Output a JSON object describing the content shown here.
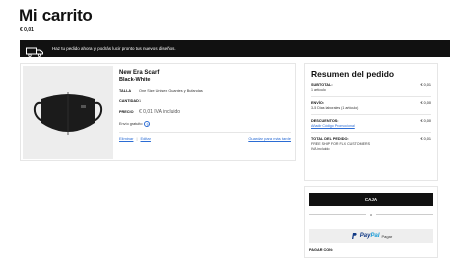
{
  "page": {
    "title": "Mi carrito",
    "total": "€ 0,01"
  },
  "banner": {
    "text": "Haz tu pedido ahora y podrás lucir pronto tus nuevos diseños.",
    "icon": "truck-icon"
  },
  "product": {
    "name": "New Era Scarf",
    "color": "Black-White",
    "attributes": [
      {
        "label": "TALLA",
        "value": "One Size Unisex Guantes y Bufandas"
      },
      {
        "label": "CANTIDAD",
        "value": "1"
      }
    ],
    "price_label": "PRECIO",
    "price_value": "€ 0,01 IVA incluido",
    "shipping_note": "Envío gratuito",
    "actions": {
      "remove": "Eliminar",
      "edit": "Editar",
      "wishlist": "Guardar para más tarde"
    }
  },
  "summary": {
    "title": "Resumen del pedido",
    "subtotal": {
      "label": "SUBTOTAL:",
      "sub": "1 artículo",
      "value": "€ 0,01"
    },
    "shipping": {
      "label": "ENVÍO:",
      "sub": "3-5 Días laborales (1 artículo)",
      "value": "€ 0,00"
    },
    "discounts": {
      "label": "DESCUENTOS:",
      "link": "Añadir Código Promocional",
      "value": "€ 0,00"
    },
    "total": {
      "label": "TOTAL DEL PEDIDO:",
      "value": "€ 0,01",
      "note1": "FREE SHIP FOR FLX CUSTOMERS",
      "note2": "IVA incluido"
    }
  },
  "checkout": {
    "caja": "CAJA",
    "or": "o",
    "paypal_a": "Pay",
    "paypal_b": "Pal",
    "paypal_c": "Pagar",
    "pay_with": "PAGAR CON:"
  }
}
